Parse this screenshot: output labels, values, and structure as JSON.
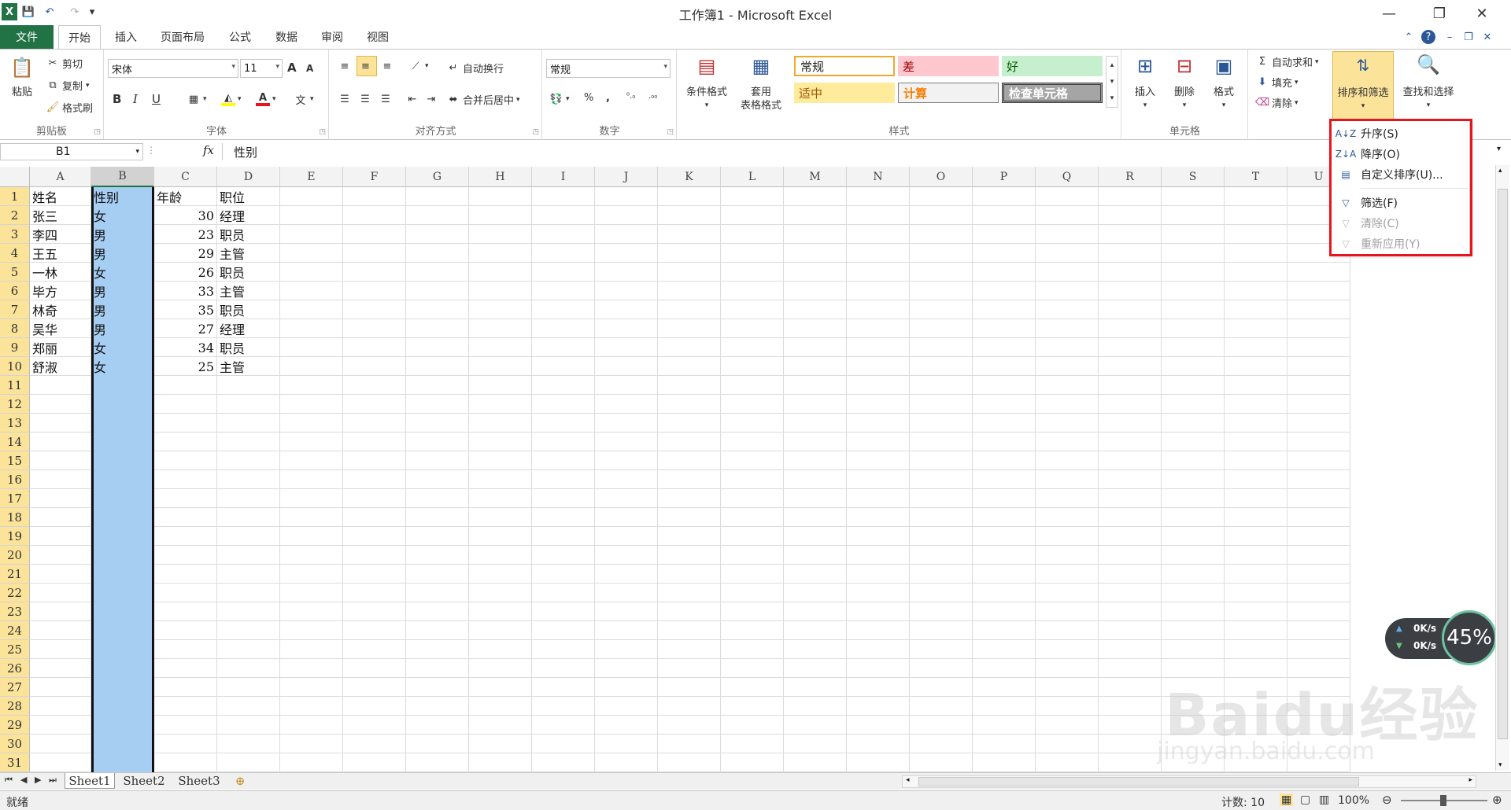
{
  "titlebar": {
    "title": "工作簿1 - Microsoft Excel",
    "min": "—",
    "restore": "❐",
    "close": "✕",
    "qa_save": "💾",
    "qa_undo": "↶",
    "qa_redo": "↷",
    "qa_custom": "▾"
  },
  "tabs": {
    "file": "文件",
    "home": "开始",
    "insert": "插入",
    "layout": "页面布局",
    "formulas": "公式",
    "data": "数据",
    "review": "审阅",
    "view": "视图"
  },
  "ribbon": {
    "clipboard": {
      "label": "剪贴板",
      "paste": "粘贴",
      "cut": "剪切",
      "copy": "复制",
      "format_painter": "格式刷"
    },
    "font": {
      "label": "字体",
      "name": "宋体",
      "size": "11",
      "bold": "B",
      "italic": "I",
      "underline": "U",
      "grow": "A",
      "shrink": "A"
    },
    "alignment": {
      "label": "对齐方式",
      "wrap": "自动换行",
      "merge": "合并后居中"
    },
    "number": {
      "label": "数字",
      "format": "常规",
      "percent": "%",
      "comma": ","
    },
    "styles": {
      "label": "样式",
      "conditional": "条件格式",
      "table1": "套用",
      "table2": "表格格式",
      "normal": "常规",
      "bad": "差",
      "good": "好",
      "neutral": "适中",
      "calc": "计算",
      "check": "检查单元格"
    },
    "cells": {
      "label": "单元格",
      "insert": "插入",
      "delete": "删除",
      "format": "格式"
    },
    "editing": {
      "autosum": "自动求和",
      "fill": "填充",
      "clear": "清除",
      "sort_filter": "排序和筛选",
      "find_select": "查找和选择"
    }
  },
  "formula_bar": {
    "name_box": "B1",
    "fx": "fx",
    "value": "性别"
  },
  "columns": [
    "A",
    "B",
    "C",
    "D",
    "E",
    "F",
    "G",
    "H",
    "I",
    "J",
    "K",
    "L",
    "M",
    "N",
    "O",
    "P",
    "Q",
    "R",
    "S",
    "T",
    "U"
  ],
  "rows": [
    "1",
    "2",
    "3",
    "4",
    "5",
    "6",
    "7",
    "8",
    "9",
    "10",
    "11",
    "12",
    "13",
    "14",
    "15",
    "16",
    "17",
    "18",
    "19",
    "20",
    "21",
    "22",
    "23",
    "24",
    "25",
    "26",
    "27",
    "28",
    "29",
    "30",
    "31"
  ],
  "table": {
    "headers": [
      "姓名",
      "性别",
      "年龄",
      "职位"
    ],
    "rows": [
      [
        "张三",
        "女",
        "30",
        "经理"
      ],
      [
        "李四",
        "男",
        "23",
        "职员"
      ],
      [
        "王五",
        "男",
        "29",
        "主管"
      ],
      [
        "一林",
        "女",
        "26",
        "职员"
      ],
      [
        "毕方",
        "男",
        "33",
        "主管"
      ],
      [
        "林奇",
        "男",
        "35",
        "职员"
      ],
      [
        "吴华",
        "男",
        "27",
        "经理"
      ],
      [
        "郑丽",
        "女",
        "34",
        "职员"
      ],
      [
        "舒淑",
        "女",
        "25",
        "主管"
      ]
    ]
  },
  "menu": {
    "asc": "升序(S)",
    "desc": "降序(O)",
    "custom": "自定义排序(U)...",
    "filter": "筛选(F)",
    "clear": "清除(C)",
    "reapply": "重新应用(Y)"
  },
  "sheets": [
    "Sheet1",
    "Sheet2",
    "Sheet3"
  ],
  "status": {
    "ready": "就绪",
    "count": "计数: 10",
    "zoom": "100%"
  },
  "net_widget": {
    "up": "0K/s",
    "down": "0K/s",
    "percent": "45%"
  },
  "watermark": {
    "brand": "Baidu经验",
    "url": "jingyan.baidu.com"
  },
  "colors": {
    "excel_green": "#217346",
    "selection_blue": "#a6cdf2",
    "highlight_red": "#e8141b"
  }
}
